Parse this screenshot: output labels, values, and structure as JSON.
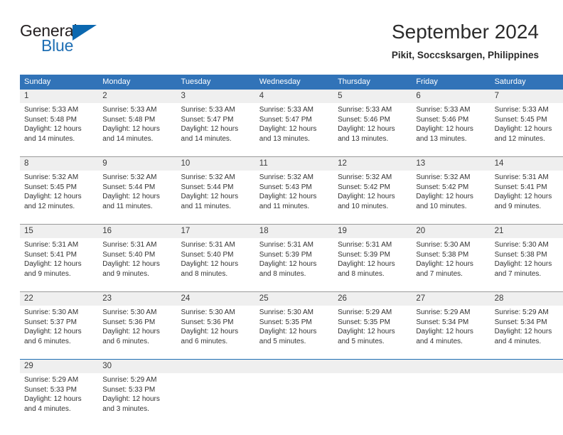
{
  "brand": {
    "line1": "General",
    "line2": "Blue",
    "triangle_color": "#0b68b0"
  },
  "header": {
    "title": "September 2024",
    "subtitle": "Pikit, Soccsksargen, Philippines"
  },
  "colors": {
    "header_bar": "#3173b8",
    "daynum_band": "#efefef",
    "separator": "#9a9a9a",
    "separator_accent": "#1f6fb4"
  },
  "weekday_headers": [
    "Sunday",
    "Monday",
    "Tuesday",
    "Wednesday",
    "Thursday",
    "Friday",
    "Saturday"
  ],
  "weeks": [
    {
      "separator": "gray",
      "days": [
        {
          "num": "1",
          "sunrise": "Sunrise: 5:33 AM",
          "sunset": "Sunset: 5:48 PM",
          "daylight_a": "Daylight: 12 hours",
          "daylight_b": "and 14 minutes."
        },
        {
          "num": "2",
          "sunrise": "Sunrise: 5:33 AM",
          "sunset": "Sunset: 5:48 PM",
          "daylight_a": "Daylight: 12 hours",
          "daylight_b": "and 14 minutes."
        },
        {
          "num": "3",
          "sunrise": "Sunrise: 5:33 AM",
          "sunset": "Sunset: 5:47 PM",
          "daylight_a": "Daylight: 12 hours",
          "daylight_b": "and 14 minutes."
        },
        {
          "num": "4",
          "sunrise": "Sunrise: 5:33 AM",
          "sunset": "Sunset: 5:47 PM",
          "daylight_a": "Daylight: 12 hours",
          "daylight_b": "and 13 minutes."
        },
        {
          "num": "5",
          "sunrise": "Sunrise: 5:33 AM",
          "sunset": "Sunset: 5:46 PM",
          "daylight_a": "Daylight: 12 hours",
          "daylight_b": "and 13 minutes."
        },
        {
          "num": "6",
          "sunrise": "Sunrise: 5:33 AM",
          "sunset": "Sunset: 5:46 PM",
          "daylight_a": "Daylight: 12 hours",
          "daylight_b": "and 13 minutes."
        },
        {
          "num": "7",
          "sunrise": "Sunrise: 5:33 AM",
          "sunset": "Sunset: 5:45 PM",
          "daylight_a": "Daylight: 12 hours",
          "daylight_b": "and 12 minutes."
        }
      ]
    },
    {
      "separator": "gray",
      "days": [
        {
          "num": "8",
          "sunrise": "Sunrise: 5:32 AM",
          "sunset": "Sunset: 5:45 PM",
          "daylight_a": "Daylight: 12 hours",
          "daylight_b": "and 12 minutes."
        },
        {
          "num": "9",
          "sunrise": "Sunrise: 5:32 AM",
          "sunset": "Sunset: 5:44 PM",
          "daylight_a": "Daylight: 12 hours",
          "daylight_b": "and 11 minutes."
        },
        {
          "num": "10",
          "sunrise": "Sunrise: 5:32 AM",
          "sunset": "Sunset: 5:44 PM",
          "daylight_a": "Daylight: 12 hours",
          "daylight_b": "and 11 minutes."
        },
        {
          "num": "11",
          "sunrise": "Sunrise: 5:32 AM",
          "sunset": "Sunset: 5:43 PM",
          "daylight_a": "Daylight: 12 hours",
          "daylight_b": "and 11 minutes."
        },
        {
          "num": "12",
          "sunrise": "Sunrise: 5:32 AM",
          "sunset": "Sunset: 5:42 PM",
          "daylight_a": "Daylight: 12 hours",
          "daylight_b": "and 10 minutes."
        },
        {
          "num": "13",
          "sunrise": "Sunrise: 5:32 AM",
          "sunset": "Sunset: 5:42 PM",
          "daylight_a": "Daylight: 12 hours",
          "daylight_b": "and 10 minutes."
        },
        {
          "num": "14",
          "sunrise": "Sunrise: 5:31 AM",
          "sunset": "Sunset: 5:41 PM",
          "daylight_a": "Daylight: 12 hours",
          "daylight_b": "and 9 minutes."
        }
      ]
    },
    {
      "separator": "gray",
      "days": [
        {
          "num": "15",
          "sunrise": "Sunrise: 5:31 AM",
          "sunset": "Sunset: 5:41 PM",
          "daylight_a": "Daylight: 12 hours",
          "daylight_b": "and 9 minutes."
        },
        {
          "num": "16",
          "sunrise": "Sunrise: 5:31 AM",
          "sunset": "Sunset: 5:40 PM",
          "daylight_a": "Daylight: 12 hours",
          "daylight_b": "and 9 minutes."
        },
        {
          "num": "17",
          "sunrise": "Sunrise: 5:31 AM",
          "sunset": "Sunset: 5:40 PM",
          "daylight_a": "Daylight: 12 hours",
          "daylight_b": "and 8 minutes."
        },
        {
          "num": "18",
          "sunrise": "Sunrise: 5:31 AM",
          "sunset": "Sunset: 5:39 PM",
          "daylight_a": "Daylight: 12 hours",
          "daylight_b": "and 8 minutes."
        },
        {
          "num": "19",
          "sunrise": "Sunrise: 5:31 AM",
          "sunset": "Sunset: 5:39 PM",
          "daylight_a": "Daylight: 12 hours",
          "daylight_b": "and 8 minutes."
        },
        {
          "num": "20",
          "sunrise": "Sunrise: 5:30 AM",
          "sunset": "Sunset: 5:38 PM",
          "daylight_a": "Daylight: 12 hours",
          "daylight_b": "and 7 minutes."
        },
        {
          "num": "21",
          "sunrise": "Sunrise: 5:30 AM",
          "sunset": "Sunset: 5:38 PM",
          "daylight_a": "Daylight: 12 hours",
          "daylight_b": "and 7 minutes."
        }
      ]
    },
    {
      "separator": "gray",
      "days": [
        {
          "num": "22",
          "sunrise": "Sunrise: 5:30 AM",
          "sunset": "Sunset: 5:37 PM",
          "daylight_a": "Daylight: 12 hours",
          "daylight_b": "and 6 minutes."
        },
        {
          "num": "23",
          "sunrise": "Sunrise: 5:30 AM",
          "sunset": "Sunset: 5:36 PM",
          "daylight_a": "Daylight: 12 hours",
          "daylight_b": "and 6 minutes."
        },
        {
          "num": "24",
          "sunrise": "Sunrise: 5:30 AM",
          "sunset": "Sunset: 5:36 PM",
          "daylight_a": "Daylight: 12 hours",
          "daylight_b": "and 6 minutes."
        },
        {
          "num": "25",
          "sunrise": "Sunrise: 5:30 AM",
          "sunset": "Sunset: 5:35 PM",
          "daylight_a": "Daylight: 12 hours",
          "daylight_b": "and 5 minutes."
        },
        {
          "num": "26",
          "sunrise": "Sunrise: 5:29 AM",
          "sunset": "Sunset: 5:35 PM",
          "daylight_a": "Daylight: 12 hours",
          "daylight_b": "and 5 minutes."
        },
        {
          "num": "27",
          "sunrise": "Sunrise: 5:29 AM",
          "sunset": "Sunset: 5:34 PM",
          "daylight_a": "Daylight: 12 hours",
          "daylight_b": "and 4 minutes."
        },
        {
          "num": "28",
          "sunrise": "Sunrise: 5:29 AM",
          "sunset": "Sunset: 5:34 PM",
          "daylight_a": "Daylight: 12 hours",
          "daylight_b": "and 4 minutes."
        }
      ]
    },
    {
      "separator": "blue",
      "days": [
        {
          "num": "29",
          "sunrise": "Sunrise: 5:29 AM",
          "sunset": "Sunset: 5:33 PM",
          "daylight_a": "Daylight: 12 hours",
          "daylight_b": "and 4 minutes."
        },
        {
          "num": "30",
          "sunrise": "Sunrise: 5:29 AM",
          "sunset": "Sunset: 5:33 PM",
          "daylight_a": "Daylight: 12 hours",
          "daylight_b": "and 3 minutes."
        },
        {
          "num": "",
          "sunrise": "",
          "sunset": "",
          "daylight_a": "",
          "daylight_b": ""
        },
        {
          "num": "",
          "sunrise": "",
          "sunset": "",
          "daylight_a": "",
          "daylight_b": ""
        },
        {
          "num": "",
          "sunrise": "",
          "sunset": "",
          "daylight_a": "",
          "daylight_b": ""
        },
        {
          "num": "",
          "sunrise": "",
          "sunset": "",
          "daylight_a": "",
          "daylight_b": ""
        },
        {
          "num": "",
          "sunrise": "",
          "sunset": "",
          "daylight_a": "",
          "daylight_b": ""
        }
      ]
    }
  ]
}
